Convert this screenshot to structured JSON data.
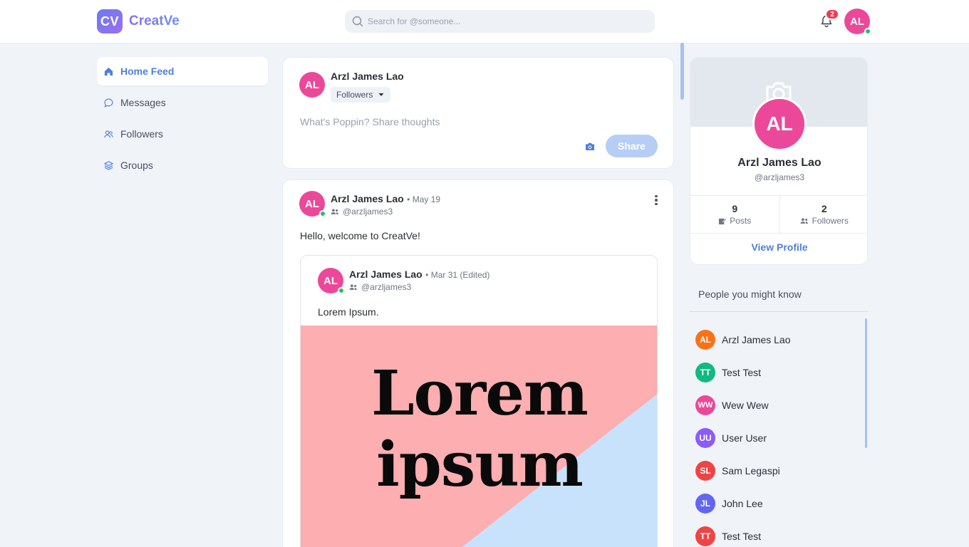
{
  "app": {
    "logo_initials": "CV",
    "name": "CreatVe"
  },
  "search": {
    "placeholder": "Search for @someone..."
  },
  "notifications": {
    "count": "2"
  },
  "current_user": {
    "initials": "AL",
    "color": "#ec4899"
  },
  "sidebar": {
    "items": [
      {
        "label": "Home Feed",
        "icon": "home-icon",
        "active": true
      },
      {
        "label": "Messages",
        "icon": "chat-bubble-icon",
        "active": false
      },
      {
        "label": "Followers",
        "icon": "users-icon",
        "active": false
      },
      {
        "label": "Groups",
        "icon": "layers-icon",
        "active": false
      }
    ]
  },
  "composer": {
    "author": "Arzl James Lao",
    "avatar_initials": "AL",
    "audience": "Followers",
    "placeholder": "What's Poppin? Share thoughts",
    "share_label": "Share"
  },
  "post": {
    "author": "Arzl James Lao",
    "date": "• May 19",
    "handle": "@arzljames3",
    "avatar_initials": "AL",
    "text": "Hello, welcome to CreatVe!",
    "shared": {
      "author": "Arzl James Lao",
      "date": "• Mar 31 (Edited)",
      "handle": "@arzljames3",
      "avatar_initials": "AL",
      "text": "Lorem Ipsum.",
      "image_line1": "Lorem",
      "image_line2": "ipsum",
      "image_colors": {
        "pink": "#fcaeb0",
        "blue": "#c9e2fb"
      }
    }
  },
  "profile_card": {
    "avatar_initials": "AL",
    "name": "Arzl James Lao",
    "handle": "@arzljames3",
    "posts_count": "9",
    "posts_label": "Posts",
    "followers_count": "2",
    "followers_label": "Followers",
    "view_profile_label": "View Profile"
  },
  "people_you_might_know": {
    "title": "People you might know",
    "people": [
      {
        "initials": "AL",
        "name": "Arzl James Lao",
        "color": "#f97316"
      },
      {
        "initials": "TT",
        "name": "Test Test",
        "color": "#10b981"
      },
      {
        "initials": "WW",
        "name": "Wew Wew",
        "color": "#ec4899"
      },
      {
        "initials": "UU",
        "name": "User User",
        "color": "#8b5cf6"
      },
      {
        "initials": "SL",
        "name": "Sam Legaspi",
        "color": "#ef4444"
      },
      {
        "initials": "JL",
        "name": "John Lee",
        "color": "#6366f1"
      },
      {
        "initials": "TT",
        "name": "Test Test",
        "color": "#ef4444"
      }
    ]
  },
  "colors": {
    "accent": "#4f7fdc",
    "brand": "#7f6df0",
    "avatar_pink": "#ec4899",
    "online": "#22c55e"
  }
}
